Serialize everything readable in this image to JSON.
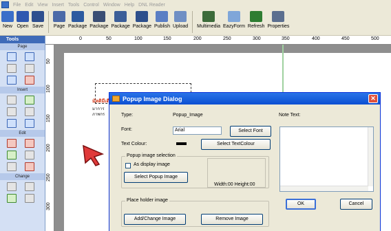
{
  "menubar": {
    "items": [
      "File",
      "Edit",
      "View",
      "Insert",
      "Tools",
      "Control",
      "Window",
      "Help",
      "DNL Reader"
    ]
  },
  "toolbar": {
    "buttons": [
      {
        "label": "New",
        "icon": "new-icon",
        "color": "#3b6fc9"
      },
      {
        "label": "Open",
        "icon": "open-icon",
        "color": "#2f58b0"
      },
      {
        "label": "Save",
        "icon": "save-icon",
        "color": "#2e4f8f"
      },
      {
        "label": "Page",
        "icon": "page-icon",
        "color": "#4b6aa8"
      },
      {
        "label": "Package",
        "icon": "package-icon",
        "color": "#2c5aa0"
      },
      {
        "label": "Package",
        "icon": "package-icon",
        "color": "#3a4e74"
      },
      {
        "label": "Package",
        "icon": "package-icon",
        "color": "#3b5e98"
      },
      {
        "label": "Package",
        "icon": "package-icon",
        "color": "#2d4f8c"
      },
      {
        "label": "Publish",
        "icon": "publish-icon",
        "color": "#5a7ec4"
      },
      {
        "label": "Upload",
        "icon": "upload-icon",
        "color": "#6f8fc4"
      },
      {
        "label": "Multimedia",
        "icon": "multimedia-icon",
        "color": "#3c6b3a"
      },
      {
        "label": "EazyForm",
        "icon": "eazyform-icon",
        "color": "#7fa6d9"
      },
      {
        "label": "Refresh",
        "icon": "refresh-icon",
        "color": "#2e7d32"
      },
      {
        "label": "Properties",
        "icon": "properties-icon",
        "color": "#5b6f8f"
      }
    ]
  },
  "toolpanel": {
    "header": "Tools",
    "sections": [
      "Page",
      "Insert",
      "Edit",
      "Change"
    ]
  },
  "ruler": {
    "h_ticks": [
      "0",
      "50",
      "100",
      "150",
      "200",
      "250",
      "300",
      "350",
      "400",
      "450",
      "500"
    ],
    "v_ticks": [
      "50",
      "100",
      "150",
      "200",
      "250",
      "300"
    ]
  },
  "canvas": {
    "text_red": "มัลติมีเดีย",
    "text_line1": "มาการ",
    "text_line2": "ภาพกร"
  },
  "dialog": {
    "title": "Popup Image Dialog",
    "type_label": "Type:",
    "type_value": "Popup_Image",
    "note_label": "Note Text:",
    "font_label": "Font:",
    "font_value": "Arial",
    "select_font": "Select Font",
    "textcolour_label": "Text Colour:",
    "textcolour_value": "#000000",
    "select_textcolour": "Select TextColour",
    "popup_group": "Popup image selection",
    "as_display": "As display image",
    "select_popup": "Select Popup Image",
    "dimensions": "Width:00 Height:00",
    "placeholder_group": "Place holder image",
    "add_change": "Add/Change Image",
    "remove_image": "Remove Image",
    "ok": "OK",
    "cancel": "Cancel",
    "close": "✕"
  }
}
